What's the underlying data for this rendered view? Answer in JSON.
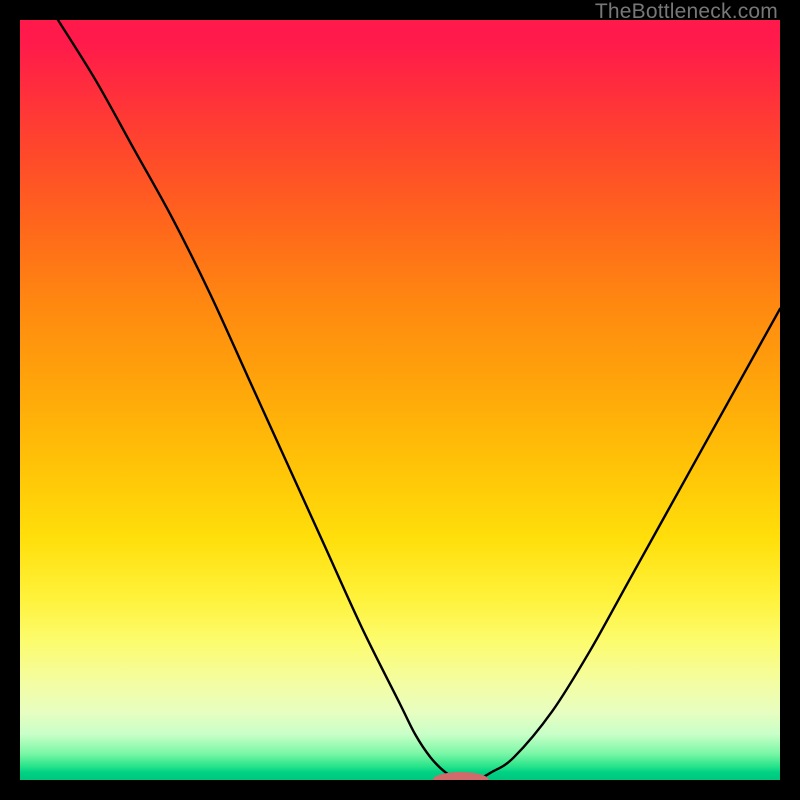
{
  "watermark": "TheBottleneck.com",
  "chart_data": {
    "type": "line",
    "title": "",
    "xlabel": "",
    "ylabel": "",
    "xlim": [
      0,
      100
    ],
    "ylim": [
      0,
      100
    ],
    "grid": false,
    "legend": false,
    "series": [
      {
        "name": "bottleneck-curve",
        "x": [
          5,
          10,
          15,
          20,
          25,
          30,
          35,
          40,
          45,
          50,
          52,
          54,
          56,
          58,
          60,
          62,
          65,
          70,
          75,
          80,
          85,
          90,
          95,
          100
        ],
        "y": [
          100,
          92,
          83,
          74,
          64,
          53,
          42,
          31,
          20,
          10,
          6,
          3,
          1,
          0,
          0,
          1,
          3,
          9,
          17,
          26,
          35,
          44,
          53,
          62
        ]
      }
    ],
    "marker": {
      "name": "bottleneck-dot",
      "x": 58,
      "y": 0,
      "color": "#d16a6a",
      "radius_x": 28,
      "radius_y": 8
    },
    "background_gradient": {
      "top": "#ff1a4b",
      "mid": "#ffde0a",
      "bottom": "#00c77e"
    }
  }
}
